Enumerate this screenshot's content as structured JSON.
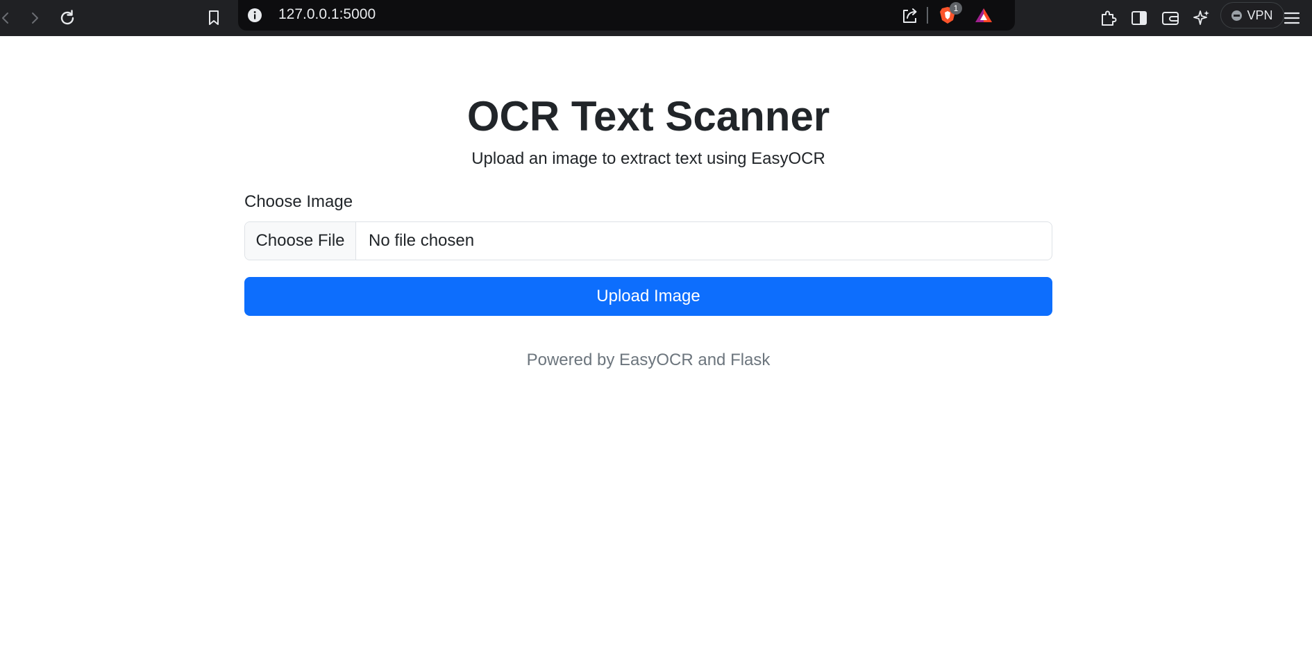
{
  "browser": {
    "url": "127.0.0.1:5000",
    "shield_badge_count": "1",
    "vpn_label": "VPN",
    "icons": [
      "back-icon",
      "forward-icon",
      "reload-icon",
      "bookmark-icon",
      "site-info-icon",
      "share-icon",
      "brave-shield-icon",
      "brave-rewards-icon",
      "extensions-icon",
      "sidebar-icon",
      "wallet-icon",
      "leo-ai-icon",
      "menu-icon"
    ]
  },
  "page": {
    "title": "OCR Text Scanner",
    "subtitle": "Upload an image to extract text using EasyOCR",
    "form": {
      "label": "Choose Image",
      "file_button_label": "Choose File",
      "file_status": "No file chosen",
      "submit_label": "Upload Image"
    },
    "footer": "Powered by EasyOCR and Flask"
  },
  "colors": {
    "toolbar_bg": "#202124",
    "primary_button": "#0d6efd",
    "muted_text": "#6c757d",
    "text": "#212529"
  }
}
